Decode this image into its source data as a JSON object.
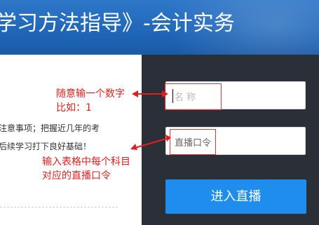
{
  "banner": {
    "title": "学习方法指导》-会计实务"
  },
  "content": {
    "lines": [
      "注意事项；把握近几年的考",
      "后续学习打下良好基础！"
    ]
  },
  "form": {
    "name_placeholder": "名    称",
    "code_placeholder": "直播口令",
    "enter_button": "进入直播"
  },
  "annotations": {
    "name_note_line1": "随意输一个数字",
    "name_note_line2": "比如：1",
    "code_note_line1": "输入表格中每个科目",
    "code_note_line2": "对应的直播口令",
    "color": "#e02020"
  },
  "colors": {
    "banner": "#1f66b8",
    "panel": "#2b3038",
    "button": "#1f8ded"
  }
}
